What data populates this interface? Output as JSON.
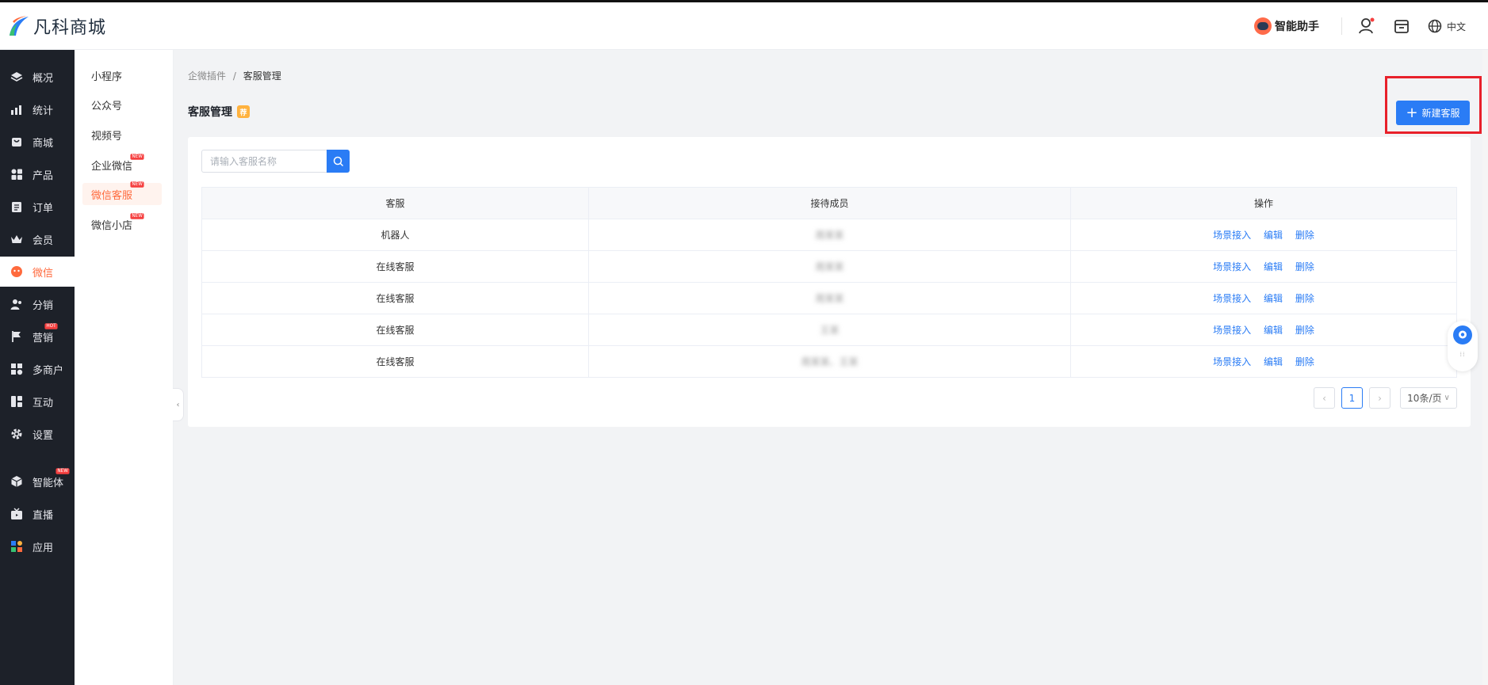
{
  "app": {
    "name": "凡科商城"
  },
  "header": {
    "assistant_label": "智能助手",
    "language_label": "中文"
  },
  "sidebar_primary": {
    "items": [
      {
        "label": "概况"
      },
      {
        "label": "统计"
      },
      {
        "label": "商城"
      },
      {
        "label": "产品"
      },
      {
        "label": "订单"
      },
      {
        "label": "会员"
      },
      {
        "label": "微信",
        "active": true
      },
      {
        "label": "分销"
      },
      {
        "label": "营销",
        "badge": "HOT"
      },
      {
        "label": "多商户"
      },
      {
        "label": "互动"
      },
      {
        "label": "设置"
      },
      {
        "label": "智能体",
        "badge": "NEW"
      },
      {
        "label": "直播"
      },
      {
        "label": "应用"
      }
    ]
  },
  "sidebar_secondary": {
    "items": [
      {
        "label": "小程序"
      },
      {
        "label": "公众号"
      },
      {
        "label": "视频号"
      },
      {
        "label": "企业微信",
        "badge": "NEW"
      },
      {
        "label": "微信客服",
        "badge": "NEW",
        "active": true
      },
      {
        "label": "微信小店",
        "badge": "NEW"
      }
    ]
  },
  "breadcrumb": {
    "parent": "企微插件",
    "separator": "/",
    "current": "客服管理"
  },
  "page": {
    "title": "客服管理",
    "title_badge": "荐"
  },
  "toolbar": {
    "new_button_label": "新建客服"
  },
  "search": {
    "placeholder": "请输入客服名称",
    "value": ""
  },
  "table": {
    "columns": [
      "客服",
      "接待成员",
      "操作"
    ],
    "rows": [
      {
        "name": "机器人",
        "members": "周某某"
      },
      {
        "name": "在线客服",
        "members": "周某某"
      },
      {
        "name": "在线客服",
        "members": "周某某"
      },
      {
        "name": "在线客服",
        "members": "王某"
      },
      {
        "name": "在线客服",
        "members": "周某某、王某"
      }
    ],
    "actions": [
      "场景接入",
      "编辑",
      "删除"
    ]
  },
  "pagination": {
    "current_page": "1",
    "page_size_label": "10条/页"
  },
  "colors": {
    "primary": "#2a7cf5",
    "accent": "#ff6a3d",
    "sidebar_bg": "#1d2129",
    "highlight": "#e8202a"
  }
}
